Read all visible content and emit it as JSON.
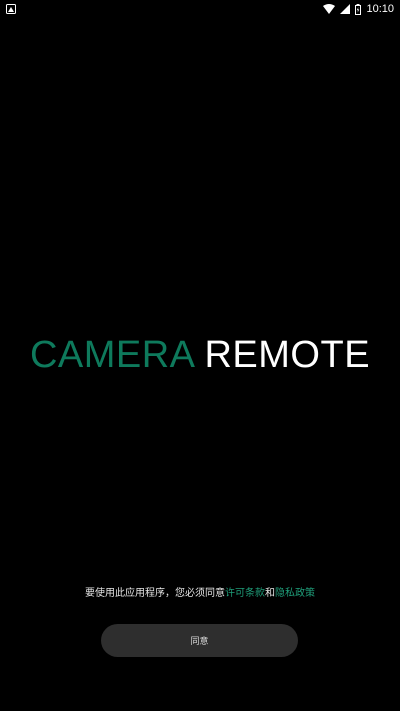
{
  "status_bar": {
    "time": "10:10",
    "icons": [
      "notification-icon",
      "wifi-icon",
      "cellular-signal-icon",
      "battery-icon"
    ]
  },
  "logo": {
    "word1": "CAMERA",
    "word2": "REMOTE",
    "accent_color": "#0e7a5c"
  },
  "consent": {
    "prefix": "要使用此应用程序，您必须同意",
    "license_link": "许可条款",
    "conjunction": "和",
    "privacy_link": "隐私政策"
  },
  "agree_button": {
    "label": "同意"
  }
}
